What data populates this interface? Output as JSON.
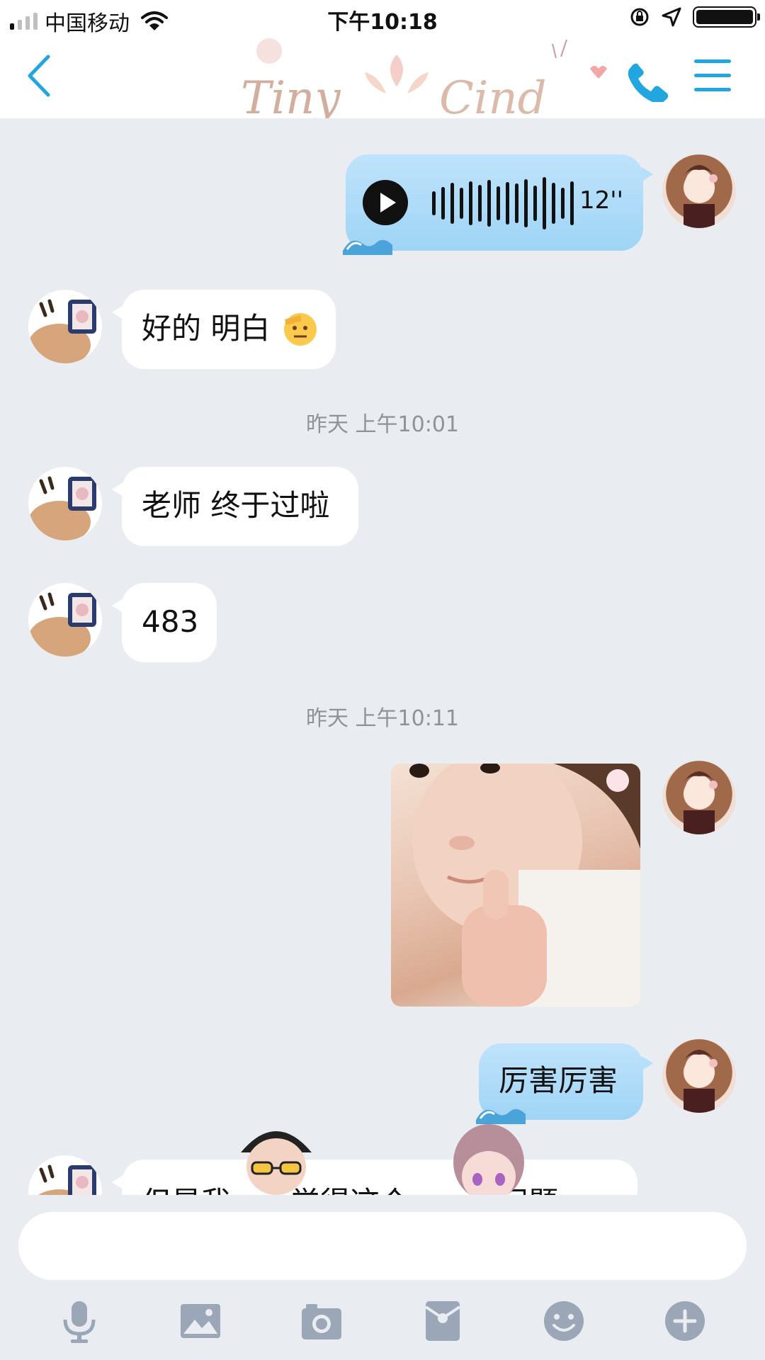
{
  "status_bar": {
    "carrier": "中国移动",
    "time": "下午10:18"
  },
  "header": {
    "icons": [
      "back-chevron-icon",
      "phone-icon",
      "menu-icon"
    ]
  },
  "messages": [
    {
      "side": "right",
      "type": "voice",
      "duration": "12''"
    },
    {
      "side": "left",
      "type": "text",
      "text": "好的 明白",
      "emoji": "saluting-face-emoji"
    },
    {
      "type": "timestamp",
      "text": "昨天 上午10:01"
    },
    {
      "side": "left",
      "type": "text",
      "text": "老师 终于过啦"
    },
    {
      "side": "left",
      "type": "text",
      "text": "483"
    },
    {
      "type": "timestamp",
      "text": "昨天 上午10:11"
    },
    {
      "side": "right",
      "type": "image",
      "description_icon": "thumbs-up-baby-sticker"
    },
    {
      "side": "right",
      "type": "text",
      "text": "厉害厉害"
    },
    {
      "side": "left",
      "type": "text",
      "text": "但是我……觉得这个……点问题",
      "partially_hidden": true
    }
  ],
  "input_bar": {
    "placeholder": "",
    "tools": [
      "microphone-icon",
      "image-icon",
      "camera-icon",
      "red-packet-icon",
      "emoji-icon",
      "plus-icon"
    ]
  },
  "colors": {
    "accent": "#22a6e0",
    "chat_bg": "#e9edf2",
    "bubble_blue": "#a9dbf8",
    "timestamp": "#8e9299",
    "toolbar_icon": "#9ba6b6"
  }
}
